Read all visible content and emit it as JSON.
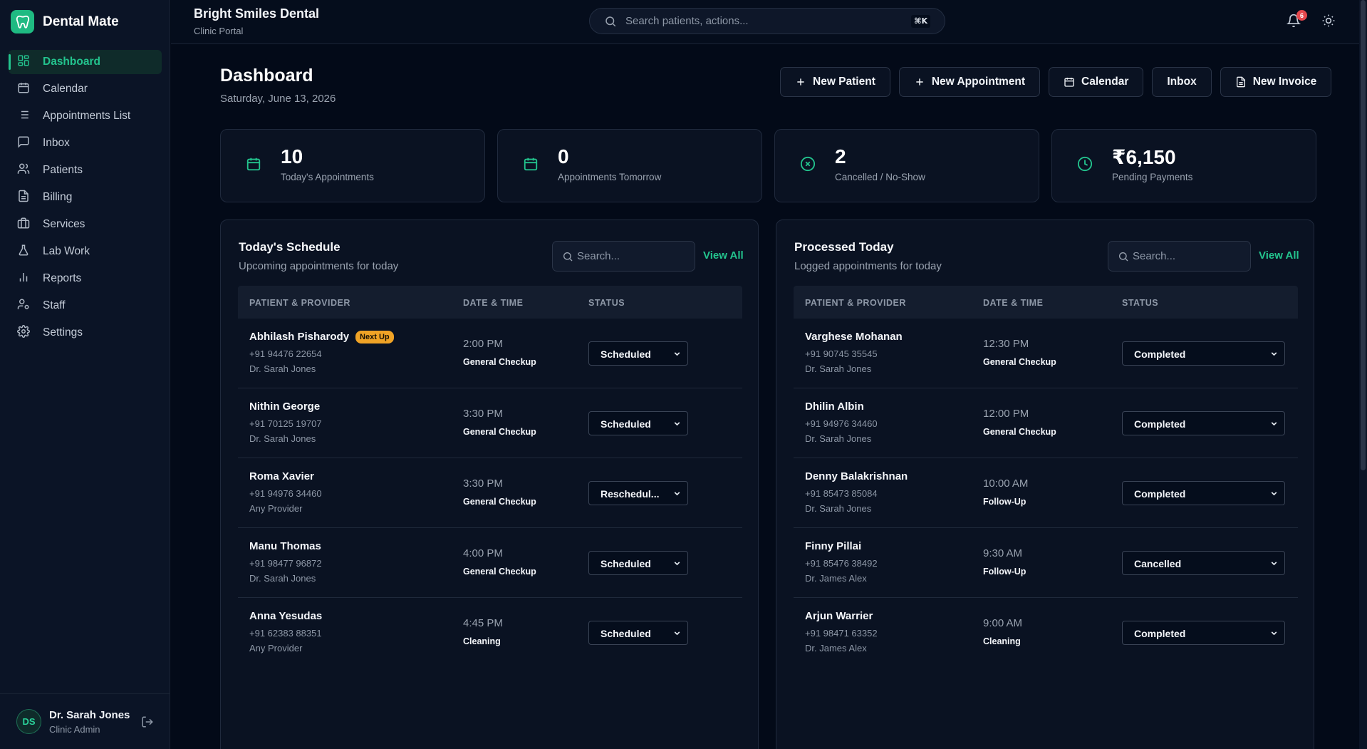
{
  "app": {
    "name": "Dental Mate"
  },
  "sidebar": {
    "items": [
      {
        "label": "Dashboard",
        "icon": "dashboard-icon",
        "active": true
      },
      {
        "label": "Calendar",
        "icon": "calendar-icon"
      },
      {
        "label": "Appointments List",
        "icon": "list-icon"
      },
      {
        "label": "Inbox",
        "icon": "chat-icon"
      },
      {
        "label": "Patients",
        "icon": "users-icon"
      },
      {
        "label": "Billing",
        "icon": "document-icon"
      },
      {
        "label": "Services",
        "icon": "briefcase-icon"
      },
      {
        "label": "Lab Work",
        "icon": "flask-icon"
      },
      {
        "label": "Reports",
        "icon": "bar-chart-icon"
      },
      {
        "label": "Staff",
        "icon": "user-cog-icon"
      },
      {
        "label": "Settings",
        "icon": "gear-icon"
      }
    ],
    "user": {
      "initials": "DS",
      "name": "Dr. Sarah Jones",
      "role": "Clinic Admin"
    }
  },
  "header": {
    "clinic_name": "Bright Smiles Dental",
    "clinic_sub": "Clinic Portal",
    "search_placeholder": "Search patients, actions...",
    "shortcut": "⌘K",
    "notification_count": "6"
  },
  "page": {
    "title": "Dashboard",
    "date": "Saturday, June 13, 2026",
    "actions": [
      {
        "label": "New Patient",
        "icon": "plus-icon"
      },
      {
        "label": "New Appointment",
        "icon": "plus-icon"
      },
      {
        "label": "Calendar",
        "icon": "calendar-icon"
      },
      {
        "label": "Inbox",
        "icon": ""
      },
      {
        "label": "New Invoice",
        "icon": "document-icon"
      }
    ]
  },
  "stats": [
    {
      "value": "10",
      "label": "Today's Appointments",
      "icon": "calendar-icon"
    },
    {
      "value": "0",
      "label": "Appointments Tomorrow",
      "icon": "calendar-icon"
    },
    {
      "value": "2",
      "label": "Cancelled / No-Show",
      "icon": "x-circle-icon"
    },
    {
      "value": "₹6,150",
      "label": "Pending Payments",
      "icon": "clock-icon"
    }
  ],
  "colors": {
    "accent": "#23c48e",
    "badge": "#f0a326",
    "background": "#030a18",
    "notification": "#e5484d"
  },
  "schedule": {
    "title": "Today's Schedule",
    "subtitle": "Upcoming appointments for today",
    "search_placeholder": "Search...",
    "view_all": "View All",
    "columns": [
      "PATIENT & PROVIDER",
      "DATE & TIME",
      "STATUS"
    ],
    "rows": [
      {
        "name": "Abhilash Pisharody",
        "badge": "Next Up",
        "phone": "+91 94476 22654",
        "provider": "Dr. Sarah Jones",
        "time": "2:00 PM",
        "service": "General Checkup",
        "status": "Scheduled"
      },
      {
        "name": "Nithin George",
        "badge": "",
        "phone": "+91 70125 19707",
        "provider": "Dr. Sarah Jones",
        "time": "3:30 PM",
        "service": "General Checkup",
        "status": "Scheduled"
      },
      {
        "name": "Roma Xavier",
        "badge": "",
        "phone": "+91 94976 34460",
        "provider": "Any Provider",
        "time": "3:30 PM",
        "service": "General Checkup",
        "status": "Reschedul..."
      },
      {
        "name": "Manu Thomas",
        "badge": "",
        "phone": "+91 98477 96872",
        "provider": "Dr. Sarah Jones",
        "time": "4:00 PM",
        "service": "General Checkup",
        "status": "Scheduled"
      },
      {
        "name": "Anna Yesudas",
        "badge": "",
        "phone": "+91 62383 88351",
        "provider": "Any Provider",
        "time": "4:45 PM",
        "service": "Cleaning",
        "status": "Scheduled"
      }
    ]
  },
  "processed": {
    "title": "Processed Today",
    "subtitle": "Logged appointments for today",
    "search_placeholder": "Search...",
    "view_all": "View All",
    "columns": [
      "PATIENT & PROVIDER",
      "DATE & TIME",
      "STATUS"
    ],
    "rows": [
      {
        "name": "Varghese Mohanan",
        "badge": "",
        "phone": "+91 90745 35545",
        "provider": "Dr. Sarah Jones",
        "time": "12:30 PM",
        "service": "General Checkup",
        "status": "Completed"
      },
      {
        "name": "Dhilin Albin",
        "badge": "",
        "phone": "+91 94976 34460",
        "provider": "Dr. Sarah Jones",
        "time": "12:00 PM",
        "service": "General Checkup",
        "status": "Completed"
      },
      {
        "name": "Denny Balakrishnan",
        "badge": "",
        "phone": "+91 85473 85084",
        "provider": "Dr. Sarah Jones",
        "time": "10:00 AM",
        "service": "Follow-Up",
        "status": "Completed"
      },
      {
        "name": "Finny Pillai",
        "badge": "",
        "phone": "+91 85476 38492",
        "provider": "Dr. James Alex",
        "time": "9:30 AM",
        "service": "Follow-Up",
        "status": "Cancelled"
      },
      {
        "name": "Arjun Warrier",
        "badge": "",
        "phone": "+91 98471 63352",
        "provider": "Dr. James Alex",
        "time": "9:00 AM",
        "service": "Cleaning",
        "status": "Completed"
      }
    ]
  }
}
